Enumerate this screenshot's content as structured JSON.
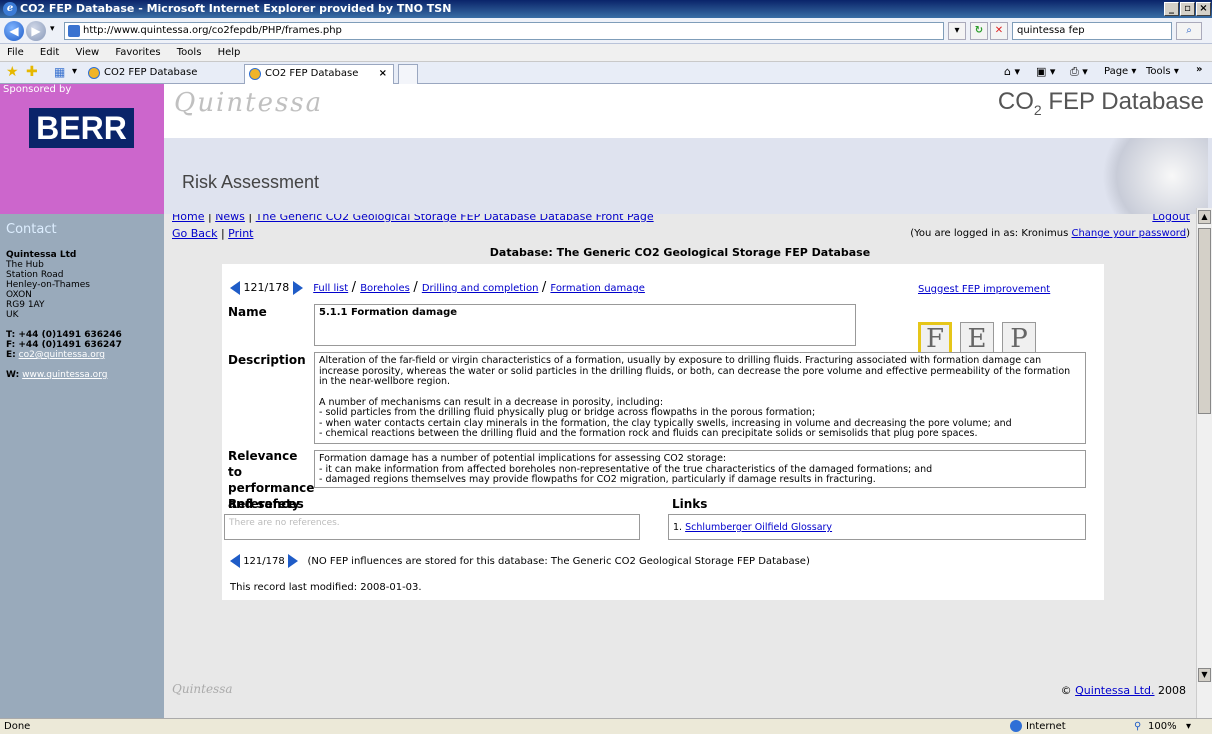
{
  "window": {
    "title": "CO2 FEP Database - Microsoft Internet Explorer provided by TNO TSN"
  },
  "addressbar": {
    "url": "http://www.quintessa.org/co2fepdb/PHP/frames.php",
    "search_value": "quintessa fep"
  },
  "menu": [
    "File",
    "Edit",
    "View",
    "Favorites",
    "Tools",
    "Help"
  ],
  "tabs": [
    {
      "label": "CO2 FEP Database"
    },
    {
      "label": "CO2 FEP Database"
    }
  ],
  "toolbar_right": {
    "page": "Page",
    "tools": "Tools"
  },
  "sponsor": {
    "label": "Sponsored by",
    "logo": "BERR"
  },
  "header": {
    "logo": "Quintessa",
    "title": "CO",
    "title_sub": "2",
    "title_rest": " FEP Database",
    "section": "Risk Assessment"
  },
  "sidebar": {
    "contact": "Contact",
    "company": "Quintessa Ltd",
    "address": [
      "The Hub",
      "Station Road",
      "Henley-on-Thames",
      "OXON",
      "RG9 1AY",
      "UK"
    ],
    "tel": "T: +44 (0)1491 636246",
    "fax": "F: +44 (0)1491 636247",
    "email_label": "E:",
    "email": "co2@quintessa.org",
    "web_label": "W:",
    "web": "www.quintessa.org"
  },
  "nav": {
    "home": "Home",
    "news": "News",
    "front_page": "The Generic CO2 Geological Storage FEP Database Database Front Page",
    "logout": "Logout",
    "go_back": "Go Back",
    "print": "Print",
    "logged_in_prefix": "(You are logged in as: Kronimus",
    "change_password": "Change your password",
    "logged_in_suffix": ")",
    "database_title": "Database: The Generic CO2 Geological Storage FEP Database"
  },
  "record": {
    "position": "121/178",
    "breadcrumb": [
      "Full list",
      "Boreholes",
      "Drilling and completion",
      "Formation damage"
    ],
    "suggest": "Suggest FEP improvement",
    "name_label": "Name",
    "name": "5.1.1 Formation damage",
    "fep_letters": [
      "F",
      "E",
      "P"
    ],
    "description_label": "Description",
    "description_p1": "Alteration of the far-field or virgin characteristics of a formation, usually by exposure to drilling fluids. Fracturing associated with formation damage can increase porosity, whereas the water or solid particles in the drilling fluids, or both, can decrease the pore volume and effective permeability of the formation in the near-wellbore region.",
    "description_p2": "A number of mechanisms can result in a decrease in porosity, including:",
    "description_items": [
      "- solid particles from the drilling fluid physically plug or bridge across flowpaths in the porous formation;",
      "- when water contacts certain clay minerals in the formation, the clay typically swells, increasing in volume and decreasing the pore volume; and",
      "- chemical reactions between the drilling fluid and the formation rock and fluids can precipitate solids or semisolids that plug pore spaces."
    ],
    "relevance_label": "Relevance to performance and safety",
    "relevance_p1": "Formation damage has a number of potential implications for assessing CO2 storage:",
    "relevance_items": [
      "- it can make information from affected boreholes non-representative of the true characteristics of the damaged formations; and",
      "- damaged regions themselves may provide flowpaths for CO2 migration, particularly if damage results in fracturing."
    ],
    "references_label": "References",
    "references_empty": "There are no references.",
    "links_label": "Links",
    "links": [
      {
        "num": "1.",
        "label": "Schlumberger Oilfield Glossary"
      }
    ],
    "influences_note": "(NO FEP influences are stored for this database: The Generic CO2 Geological Storage FEP Database)",
    "last_modified": "This record last modified: 2008-01-03."
  },
  "footer": {
    "logo": "Quintessa",
    "copyright_symbol": "©",
    "company": "Quintessa Ltd.",
    "year": "2008"
  },
  "status": {
    "left": "Done",
    "zone": "Internet",
    "zoom": "100%"
  }
}
